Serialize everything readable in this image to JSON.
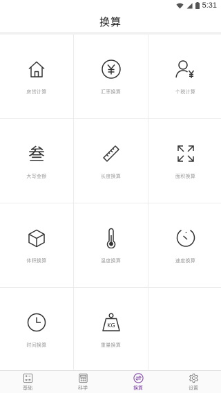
{
  "status_bar": {
    "time": "5:31",
    "icons": [
      "wifi-icon",
      "signal-icon",
      "battery-icon"
    ]
  },
  "header": {
    "title": "换算"
  },
  "grid": {
    "items": [
      {
        "label": "房贷计算",
        "icon": "house-icon"
      },
      {
        "label": "汇率换算",
        "icon": "yen-coin-icon"
      },
      {
        "label": "个税计算",
        "icon": "person-yen-icon"
      },
      {
        "label": "大写金额",
        "icon": "chinese-numeral-icon",
        "glyph": "叁"
      },
      {
        "label": "长度换算",
        "icon": "ruler-icon"
      },
      {
        "label": "面积换算",
        "icon": "expand-arrows-icon"
      },
      {
        "label": "体积换算",
        "icon": "cube-icon"
      },
      {
        "label": "温度换算",
        "icon": "thermometer-icon"
      },
      {
        "label": "速度换算",
        "icon": "speedometer-icon"
      },
      {
        "label": "时间换算",
        "icon": "clock-icon"
      },
      {
        "label": "重量换算",
        "icon": "kg-weight-icon",
        "glyph": "KG"
      }
    ]
  },
  "tab_bar": {
    "tabs": [
      {
        "label": "基础",
        "icon": "basic-calculator-icon",
        "active": false
      },
      {
        "label": "科学",
        "icon": "scientific-calculator-icon",
        "active": false
      },
      {
        "label": "换算",
        "icon": "exchange-icon",
        "active": true
      },
      {
        "label": "设置",
        "icon": "gear-icon",
        "active": false
      }
    ]
  },
  "colors": {
    "accent": "#7b3fa3",
    "icon_stroke": "#333333",
    "label": "#9a9a9a",
    "divider": "#ececec"
  }
}
